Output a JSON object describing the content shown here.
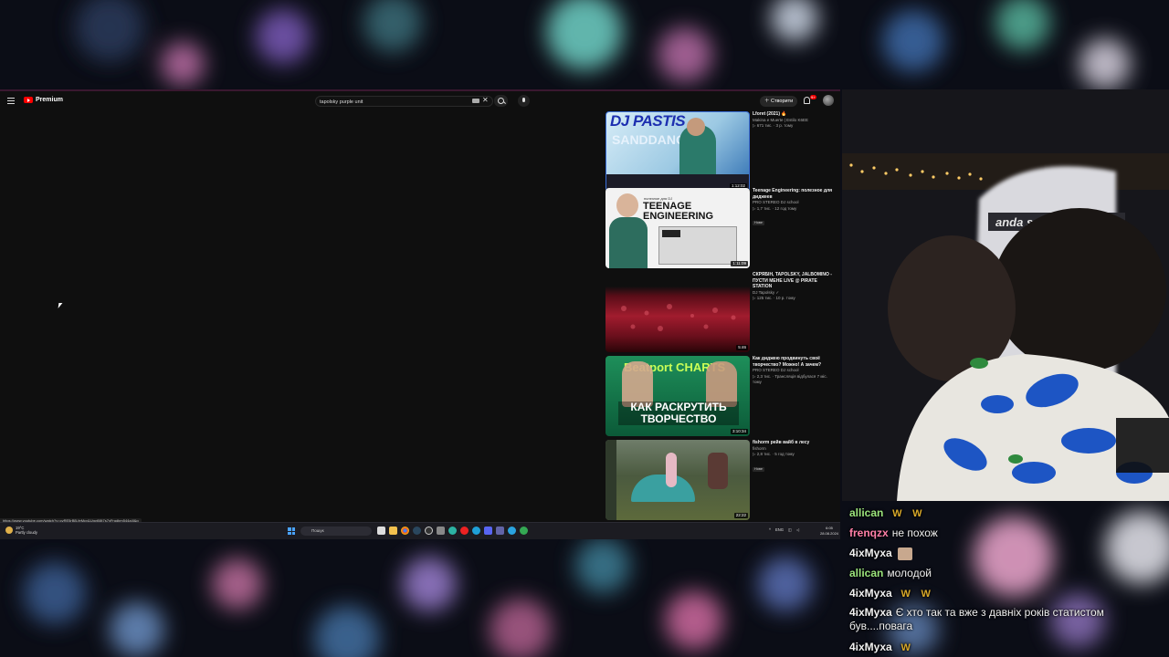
{
  "youtube": {
    "logo_text": "Premium",
    "search_query": "tapolsky purple unit",
    "create_label": "Створити",
    "notification_count": "9+",
    "status_url": "https://www.youtube.com/watch?v=cyRE5rBB-feMcv&Ugyt08t7s7yFrqdbm544a4l&g"
  },
  "recommendations": [
    {
      "title": "Lforet (2021) 🔥",
      "channel": "Makina e Muerte | Estilo K6EE",
      "stats": "▷ 671 тис. · 3 р. тому",
      "duration": "1:12:02",
      "thumb_text": "DJ PASTIS",
      "thumb_sub": "SANDDANCE",
      "badge": ""
    },
    {
      "title": "Teenage Engineering: полезное для диджеев",
      "channel": "PRO STEREO DJ school",
      "stats": "▷ 1,7 тис. · 12 год тому",
      "duration": "1:11:09",
      "thumb_text": "TEENAGE ENGINEERING",
      "thumb_sub": "полезное для DJ",
      "badge": "Нове"
    },
    {
      "title": "СКРЯБІН, TAPOLSKY, JALBOMINO - ПУСТИ МЕНЕ LIVE @ PIRATE STATION",
      "channel": "DJ Tapolsky ✓",
      "stats": "▷ 125 тис. · 10 р. тому",
      "duration": "5:46",
      "thumb_text": "",
      "thumb_sub": "",
      "badge": ""
    },
    {
      "title": "Как диджею продвинуть своё творчество? Можно! А зачем?",
      "channel": "PRO STEREO DJ school",
      "stats": "▷ 2,3 тис. · Трансляція відбулася 7 міс. тому",
      "duration": "3:10:34",
      "thumb_text": "КАК РАСКРУТИТЬ ТВОРЧЕСТВО",
      "thumb_sub": "Beatport CHARTS",
      "badge": ""
    },
    {
      "title": "fishorm рейв вайб в лесу",
      "channel": "fishorm",
      "stats": "▷ 2,8 тис. · 5 год тому",
      "duration": "22:22",
      "thumb_text": "",
      "thumb_sub": "",
      "badge": "Нове"
    }
  ],
  "taskbar": {
    "weather_temp": "19°C",
    "weather_desc": "Partly cloudy",
    "search_placeholder": "Пошук",
    "lang": "ENG",
    "time": "6:05",
    "date": "28.08.2024"
  },
  "chat": [
    {
      "user": "allican",
      "color": "#9be47c",
      "text": "",
      "emotes": [
        "W",
        "W"
      ]
    },
    {
      "user": "frenqzx",
      "color": "#ff7fa8",
      "text": "не похож",
      "emotes": []
    },
    {
      "user": "4ixMyxa",
      "color": "#e8e8e8",
      "text": "",
      "emotes": [
        "img"
      ]
    },
    {
      "user": "allican",
      "color": "#9be47c",
      "text": "молодой",
      "emotes": []
    },
    {
      "user": "4ixMyxa",
      "color": "#e8e8e8",
      "text": "",
      "emotes": [
        "W",
        "W"
      ]
    },
    {
      "user": "4ixMyxa",
      "color": "#e8e8e8",
      "text": "Є хто так та вже з давніх років статистом був....повага",
      "emotes": []
    },
    {
      "user": "4ixMyxa",
      "color": "#e8e8e8",
      "text": "",
      "emotes": [
        "W"
      ]
    }
  ],
  "cam": {
    "chair_brand": "anda seaT"
  }
}
